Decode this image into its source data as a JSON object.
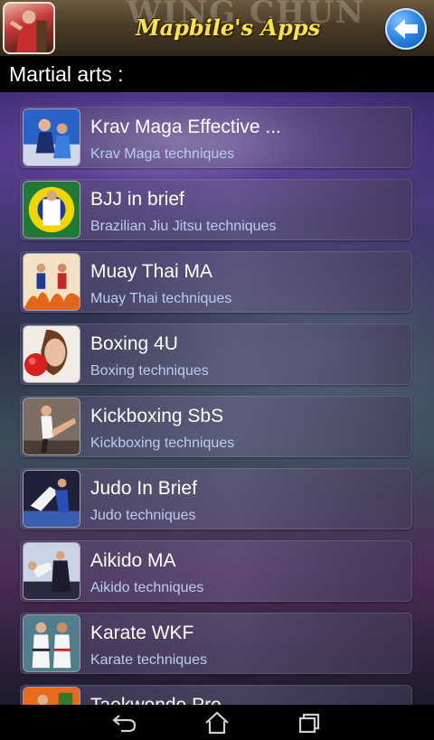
{
  "header": {
    "bg_text": "WING CHUN",
    "brand": "Mapbile's Apps",
    "app_icon": "martial-artist-icon",
    "back_icon": "back-arrow-icon"
  },
  "section": {
    "title": "Martial arts :"
  },
  "apps": [
    {
      "title": "Krav Maga Effective ...",
      "subtitle": "Krav Maga techniques",
      "icon": "krav-maga-thumbnail"
    },
    {
      "title": "BJJ in brief",
      "subtitle": "Brazilian Jiu Jitsu techniques",
      "icon": "bjj-thumbnail"
    },
    {
      "title": "Muay Thai MA",
      "subtitle": "Muay Thai techniques",
      "icon": "muay-thai-thumbnail"
    },
    {
      "title": "Boxing 4U",
      "subtitle": "Boxing techniques",
      "icon": "boxing-thumbnail"
    },
    {
      "title": "Kickboxing SbS",
      "subtitle": "Kickboxing techniques",
      "icon": "kickboxing-thumbnail"
    },
    {
      "title": "Judo In Brief",
      "subtitle": "Judo techniques",
      "icon": "judo-thumbnail"
    },
    {
      "title": "Aikido MA",
      "subtitle": "Aikido techniques",
      "icon": "aikido-thumbnail"
    },
    {
      "title": "Karate WKF",
      "subtitle": "Karate techniques",
      "icon": "karate-thumbnail"
    },
    {
      "title": "Taekwondo Pro",
      "subtitle": "",
      "icon": "taekwondo-thumbnail"
    }
  ],
  "navbar": {
    "back": "nav-back-icon",
    "home": "nav-home-icon",
    "recents": "nav-recents-icon"
  },
  "colors": {
    "brand_text": "#f4e64a",
    "subtitle": "#b9cdf2",
    "back_button": "#2b86e3"
  }
}
